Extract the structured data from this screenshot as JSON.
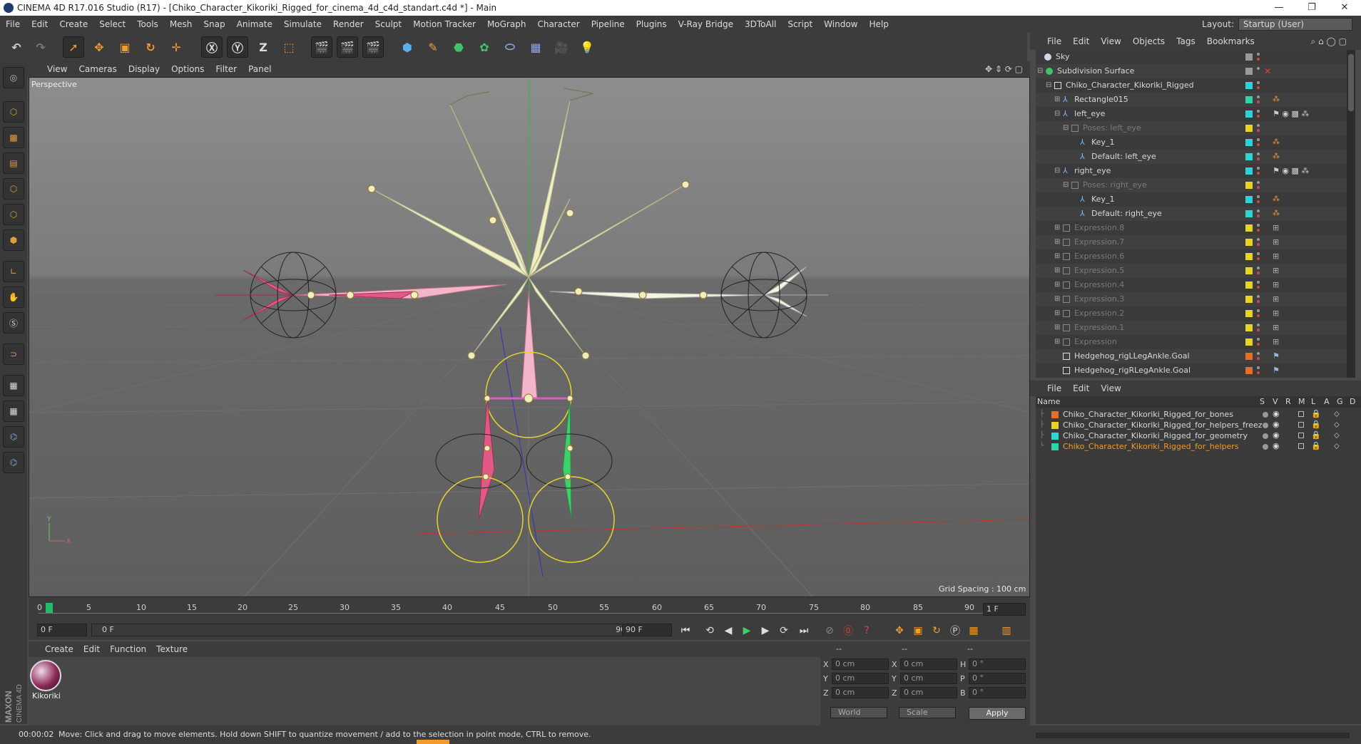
{
  "window": {
    "title": "CINEMA 4D R17.016 Studio (R17) - [Chiko_Character_Kikoriki_Rigged_for_cinema_4d_c4d_standart.c4d *] - Main",
    "controls": [
      "—",
      "❐",
      "✕"
    ]
  },
  "menubar": {
    "items": [
      "File",
      "Edit",
      "Create",
      "Select",
      "Tools",
      "Mesh",
      "Snap",
      "Animate",
      "Simulate",
      "Render",
      "Sculpt",
      "Motion Tracker",
      "MoGraph",
      "Character",
      "Pipeline",
      "Plugins",
      "V-Ray Bridge",
      "3DToAll",
      "Script",
      "Window",
      "Help"
    ],
    "layout_label": "Layout:",
    "layout_value": "Startup (User)"
  },
  "viewport": {
    "menu": [
      "View",
      "Cameras",
      "Display",
      "Options",
      "Filter",
      "Panel"
    ],
    "name": "Perspective",
    "grid_spacing": "Grid Spacing : 100 cm",
    "axis_y": "Y",
    "axis_x": "X"
  },
  "timeline": {
    "ticks": [
      "0",
      "5",
      "10",
      "15",
      "20",
      "25",
      "30",
      "35",
      "40",
      "45",
      "50",
      "55",
      "60",
      "65",
      "70",
      "75",
      "80",
      "85",
      "90"
    ],
    "current_frame_field": "1 F",
    "start_field": "0 F",
    "range_start": "0 F",
    "range_end": "90 F",
    "end_field": "90 F"
  },
  "material_manager": {
    "menu": [
      "Create",
      "Edit",
      "Function",
      "Texture"
    ],
    "materials": [
      {
        "name": "Kikoriki"
      }
    ]
  },
  "coordinates": {
    "headers": [
      "--",
      "--",
      "--"
    ],
    "rows": [
      {
        "axis": "X",
        "pos": "0 cm",
        "axis2": "X",
        "size": "0 cm",
        "rot_axis": "H",
        "rot": "0 °"
      },
      {
        "axis": "Y",
        "pos": "0 cm",
        "axis2": "Y",
        "size": "0 cm",
        "rot_axis": "P",
        "rot": "0 °"
      },
      {
        "axis": "Z",
        "pos": "0 cm",
        "axis2": "Z",
        "size": "0 cm",
        "rot_axis": "B",
        "rot": "0 °"
      }
    ],
    "space": "World",
    "mode": "Scale",
    "apply": "Apply"
  },
  "object_manager": {
    "menu": [
      "File",
      "Edit",
      "View",
      "Objects",
      "Tags",
      "Bookmarks"
    ],
    "objects": [
      {
        "name": "Sky",
        "indent": 0,
        "tag_color": "#9a9a9a",
        "dim": false
      },
      {
        "name": "Subdivision Surface",
        "indent": 0,
        "tag_color": "#9a9a9a",
        "dim": false
      },
      {
        "name": "Chiko_Character_Kikoriki_Rigged",
        "indent": 1,
        "tag_color": "#2fd3d8",
        "dim": false
      },
      {
        "name": "Rectangle015",
        "indent": 2,
        "tag_color": "#2fd3a8",
        "dim": false
      },
      {
        "name": "left_eye",
        "indent": 2,
        "tag_color": "#2fd3d8",
        "dim": false
      },
      {
        "name": "Poses: left_eye",
        "indent": 3,
        "tag_color": "#e6d42a",
        "dim": true
      },
      {
        "name": "Key_1",
        "indent": 4,
        "tag_color": "#2fd3d8",
        "dim": false
      },
      {
        "name": "Default: left_eye",
        "indent": 4,
        "tag_color": "#2fd3d8",
        "dim": false
      },
      {
        "name": "right_eye",
        "indent": 2,
        "tag_color": "#2fd3d8",
        "dim": false
      },
      {
        "name": "Poses: right_eye",
        "indent": 3,
        "tag_color": "#e6d42a",
        "dim": true
      },
      {
        "name": "Key_1",
        "indent": 4,
        "tag_color": "#2fd3d8",
        "dim": false
      },
      {
        "name": "Default: right_eye",
        "indent": 4,
        "tag_color": "#2fd3d8",
        "dim": false
      },
      {
        "name": "Expression.8",
        "indent": 2,
        "tag_color": "#e6d42a",
        "dim": true
      },
      {
        "name": "Expression.7",
        "indent": 2,
        "tag_color": "#e6d42a",
        "dim": true
      },
      {
        "name": "Expression.6",
        "indent": 2,
        "tag_color": "#e6d42a",
        "dim": true
      },
      {
        "name": "Expression.5",
        "indent": 2,
        "tag_color": "#e6d42a",
        "dim": true
      },
      {
        "name": "Expression.4",
        "indent": 2,
        "tag_color": "#e6d42a",
        "dim": true
      },
      {
        "name": "Expression.3",
        "indent": 2,
        "tag_color": "#e6d42a",
        "dim": true
      },
      {
        "name": "Expression.2",
        "indent": 2,
        "tag_color": "#e6d42a",
        "dim": true
      },
      {
        "name": "Expression.1",
        "indent": 2,
        "tag_color": "#e6d42a",
        "dim": true
      },
      {
        "name": "Expression",
        "indent": 2,
        "tag_color": "#e6d42a",
        "dim": true
      },
      {
        "name": "Hedgehog_rigLLegAnkle.Goal",
        "indent": 2,
        "tag_color": "#e0702a",
        "dim": false
      },
      {
        "name": "Hedgehog_rigRLegAnkle.Goal",
        "indent": 2,
        "tag_color": "#e0702a",
        "dim": false
      }
    ]
  },
  "layer_manager": {
    "menu": [
      "File",
      "Edit",
      "View"
    ],
    "columns": [
      "Name",
      "S",
      "V",
      "R",
      "M",
      "L",
      "A",
      "G",
      "D"
    ],
    "layers": [
      {
        "name": "Chiko_Character_Kikoriki_Rigged_for_bones",
        "color": "#e0702a",
        "active": false
      },
      {
        "name": "Chiko_Character_Kikoriki_Rigged_for_helpers_freez",
        "color": "#e6d42a",
        "active": false
      },
      {
        "name": "Chiko_Character_Kikoriki_Rigged_for_geometry",
        "color": "#2fd3d8",
        "active": false
      },
      {
        "name": "Chiko_Character_Kikoriki_Rigged_for_helpers",
        "color": "#2fd3a8",
        "active": true
      }
    ]
  },
  "statusbar": {
    "time": "00:00:02",
    "message": "Move: Click and drag to move elements. Hold down SHIFT to quantize movement / add to the selection in point mode, CTRL to remove."
  },
  "colors": {
    "accent_orange": "#f29a2e",
    "active_layer": "#f29a2e",
    "playhead": "#1fbf6a"
  }
}
